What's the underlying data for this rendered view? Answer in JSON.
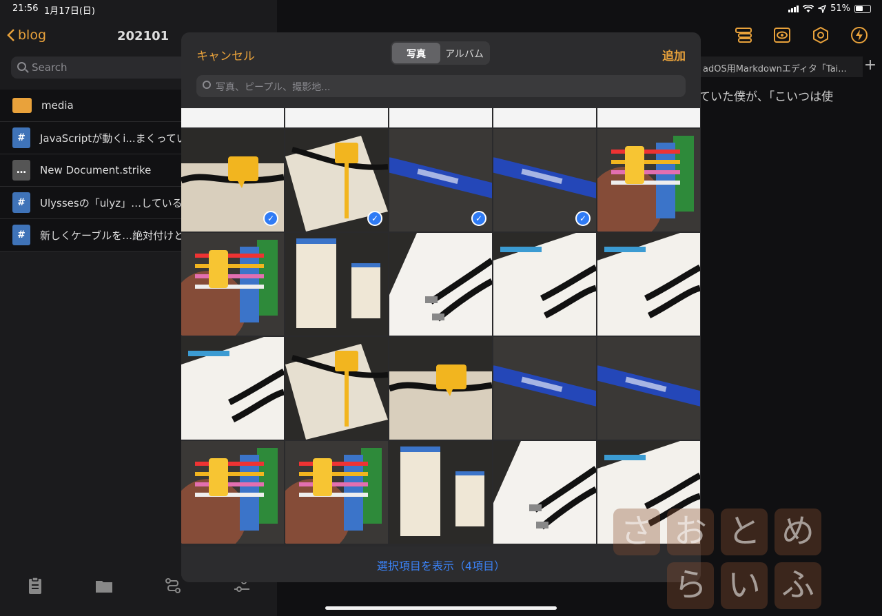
{
  "status_bar": {
    "time": "21:56",
    "date": "1月17日(日)",
    "battery": "51%"
  },
  "sidebar": {
    "back_label": "blog",
    "title": "202101",
    "search_placeholder": "Search",
    "items": [
      {
        "type": "folder",
        "label": "media",
        "icon": "folder-icon"
      },
      {
        "type": "markdown",
        "label": "JavaScriptが動くi...まくっている",
        "icon": "markdown-file-icon"
      },
      {
        "type": "strike",
        "label": "New Document.strike",
        "icon": "document-icon"
      },
      {
        "type": "markdown",
        "label": "Ulyssesの「ulyz」…しているの",
        "icon": "markdown-file-icon"
      },
      {
        "type": "markdown",
        "label": "新しくケーブルを…絶対付けとけ",
        "icon": "markdown-file-icon"
      }
    ],
    "file_icon_glyphs": {
      "markdown": "#",
      "strike": "…"
    },
    "toolbar": [
      "clipboard-icon",
      "folder-icon",
      "route-icon",
      "sliders-icon"
    ]
  },
  "editor": {
    "tab_title": "adOS用Markdownエディタ「Tai...",
    "plus": "+",
    "body_text": "ていた僕が、「こいつは使",
    "toolbar_icons": [
      "outline-icon",
      "preview-icon",
      "settings-icon",
      "action-icon"
    ],
    "accent": "#e9a23b"
  },
  "photo_picker": {
    "cancel_label": "キャンセル",
    "add_label": "追加",
    "segments": [
      "写真",
      "アルバム"
    ],
    "selected_segment": "写真",
    "search_placeholder": "写真、ピープル、撮影地...",
    "footer_label": "選択項目を表示（4項目）",
    "photos": [
      {
        "kind": "doc",
        "selected": false
      },
      {
        "kind": "doc",
        "selected": false
      },
      {
        "kind": "doc",
        "selected": false
      },
      {
        "kind": "doc",
        "selected": false
      },
      {
        "kind": "doc",
        "selected": false
      },
      {
        "kind": "cable-tag",
        "selected": true
      },
      {
        "kind": "cable-tag-box",
        "selected": true
      },
      {
        "kind": "pen",
        "selected": true
      },
      {
        "kind": "pen",
        "selected": true
      },
      {
        "kind": "tags",
        "selected": false
      },
      {
        "kind": "tags",
        "selected": false
      },
      {
        "kind": "boxes",
        "selected": false
      },
      {
        "kind": "cable",
        "selected": false
      },
      {
        "kind": "cable-box",
        "selected": false
      },
      {
        "kind": "cable-box",
        "selected": false
      },
      {
        "kind": "cable-box",
        "selected": false
      },
      {
        "kind": "cable-tag-box",
        "selected": false
      },
      {
        "kind": "cable-tag",
        "selected": false
      },
      {
        "kind": "pen",
        "selected": false
      },
      {
        "kind": "pen",
        "selected": false
      },
      {
        "kind": "tags",
        "selected": false
      },
      {
        "kind": "tags",
        "selected": false
      },
      {
        "kind": "boxes",
        "selected": false
      },
      {
        "kind": "cable",
        "selected": false
      },
      {
        "kind": "cable-box",
        "selected": false
      }
    ],
    "selection_color": "#2f7bf5"
  },
  "watermark": [
    "さ",
    "お",
    "と",
    "め",
    "ら",
    "い",
    "ふ"
  ]
}
